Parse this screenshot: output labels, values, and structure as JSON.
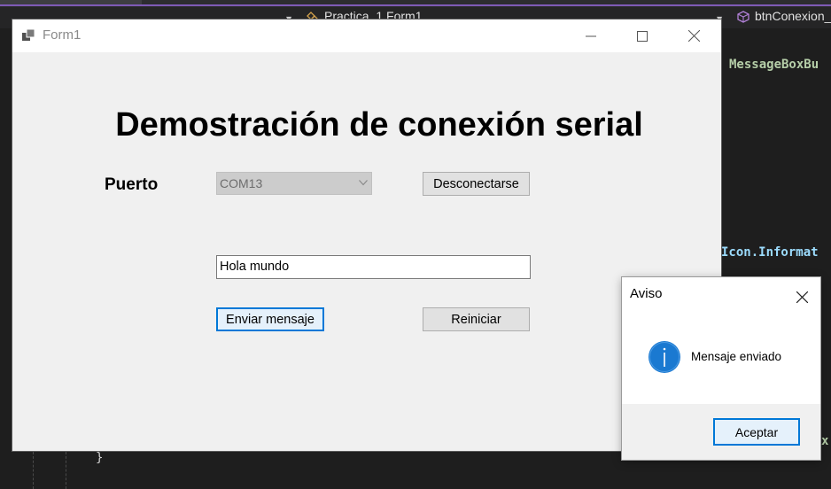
{
  "ide": {
    "nav_combo_1": "",
    "nav_combo_2": "Practica_1.Form1",
    "nav_combo_3": "btnConexion_",
    "code_lines": {
      "line_messagebox": "MessageBoxBu",
      "line_icon": "Icon.Informat",
      "line_brace": "}",
      "line_partial": "x"
    }
  },
  "form": {
    "title": "Form1",
    "heading": "Demostración de conexión serial",
    "port_label": "Puerto",
    "port_combo_value": "COM13",
    "disconnect_button": "Desconectarse",
    "message_input_value": "Hola mundo",
    "send_button": "Enviar mensaje",
    "reset_button": "Reiniciar"
  },
  "dialog": {
    "title": "Aviso",
    "message": "Mensaje enviado",
    "ok_button": "Aceptar",
    "icon": "information-icon"
  },
  "colors": {
    "ide_background": "#1e1e1e",
    "form_background": "#f0f0f0",
    "accent_blue": "#0078d7",
    "info_icon_blue": "#1a79d1"
  }
}
